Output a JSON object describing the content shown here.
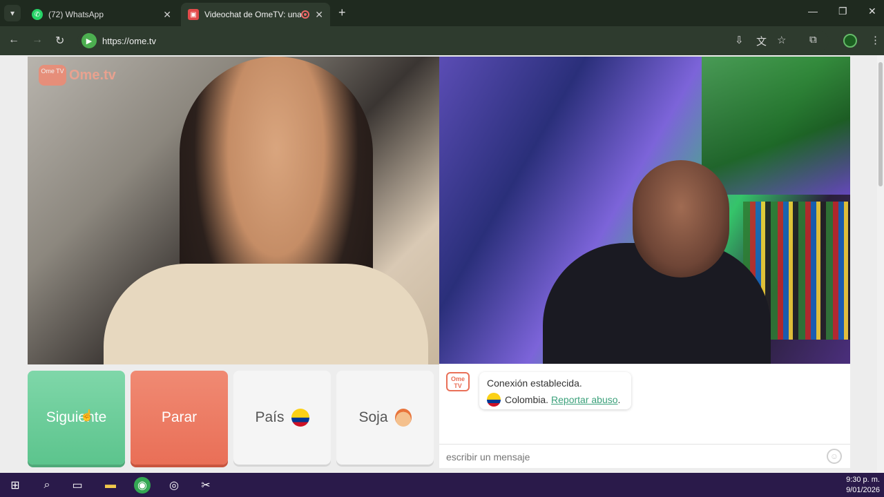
{
  "browser": {
    "tabs": [
      {
        "title": "(72) WhatsApp",
        "active": false,
        "icon": "whatsapp-icon"
      },
      {
        "title": "Videochat de OmeTV: una a",
        "active": true,
        "icon": "ometv-icon",
        "recording": true
      }
    ],
    "url": "https://ome.tv"
  },
  "site": {
    "logo_small": "Ome TV",
    "logo_text": "Ome.tv"
  },
  "controls": {
    "next_label": "Siguiente",
    "stop_label": "Parar",
    "country_label": "País",
    "gender_label": "Soja"
  },
  "chat": {
    "avatar_label": "Ome TV",
    "status": "Conexión establecida.",
    "country": "Colombia",
    "separator": " .",
    "report_link": "Reportar abuso",
    "report_end": ".",
    "input_placeholder": "escribir un mensaje"
  },
  "taskbar": {
    "time": "9:30 p. m.",
    "date": "9/01/2026"
  },
  "colors": {
    "next_button": "#6fcf9b",
    "stop_button": "#ec7a62",
    "link": "#3aa07a",
    "taskbar": "#2a1a4a",
    "chrome": "#2e3b2e"
  }
}
